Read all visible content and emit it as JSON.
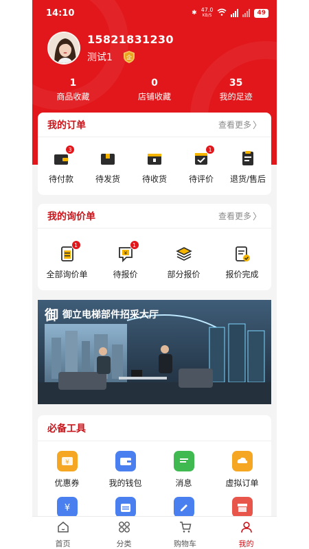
{
  "status": {
    "time": "14:10",
    "speed": "47.0",
    "speed_unit": "KB/S",
    "battery": "49"
  },
  "profile": {
    "phone": "15821831230",
    "nickname": "测试1"
  },
  "stats": [
    {
      "value": "1",
      "label": "商品收藏"
    },
    {
      "value": "0",
      "label": "店铺收藏"
    },
    {
      "value": "35",
      "label": "我的足迹"
    }
  ],
  "orders": {
    "title": "我的订单",
    "more": "查看更多",
    "items": [
      {
        "label": "待付款",
        "icon": "wallet-icon",
        "badge": "3"
      },
      {
        "label": "待发货",
        "icon": "package-icon",
        "badge": ""
      },
      {
        "label": "待收货",
        "icon": "box-receive-icon",
        "badge": ""
      },
      {
        "label": "待评价",
        "icon": "review-icon",
        "badge": "1"
      },
      {
        "label": "退货/售后",
        "icon": "return-icon",
        "badge": ""
      }
    ]
  },
  "inquiry": {
    "title": "我的询价单",
    "more": "查看更多",
    "items": [
      {
        "label": "全部询价单",
        "icon": "inquiry-list-icon",
        "badge": "1"
      },
      {
        "label": "待报价",
        "icon": "pending-quote-icon",
        "badge": "1"
      },
      {
        "label": "部分报价",
        "icon": "layers-icon",
        "badge": ""
      },
      {
        "label": "报价完成",
        "icon": "quote-done-icon",
        "badge": ""
      }
    ]
  },
  "banner": {
    "logo": "御",
    "text": "御立电梯部件招采大厅"
  },
  "tools": {
    "title": "必备工具",
    "row1": [
      {
        "label": "优惠券",
        "icon": "coupon-icon",
        "color": "#f5a623"
      },
      {
        "label": "我的钱包",
        "icon": "wallet-icon",
        "color": "#4a7ff0"
      },
      {
        "label": "消息",
        "icon": "message-icon",
        "color": "#3fb950"
      },
      {
        "label": "虚拟订单",
        "icon": "virtual-order-icon",
        "color": "#f5a623"
      }
    ],
    "row2": [
      {
        "label": "",
        "icon": "yuan-receipt-icon",
        "color": "#4a7ff0"
      },
      {
        "label": "",
        "icon": "calendar-icon",
        "color": "#4a7ff0"
      },
      {
        "label": "",
        "icon": "edit-icon",
        "color": "#4a7ff0"
      },
      {
        "label": "",
        "icon": "store-icon",
        "color": "#e8554a"
      }
    ]
  },
  "tabbar": [
    {
      "label": "首页",
      "icon": "home-icon",
      "active": false
    },
    {
      "label": "分类",
      "icon": "category-icon",
      "active": false
    },
    {
      "label": "购物车",
      "icon": "cart-icon",
      "active": false
    },
    {
      "label": "我的",
      "icon": "user-icon",
      "active": true
    }
  ],
  "colors": {
    "brand_red": "#e1171b",
    "title_red": "#c8141a"
  }
}
